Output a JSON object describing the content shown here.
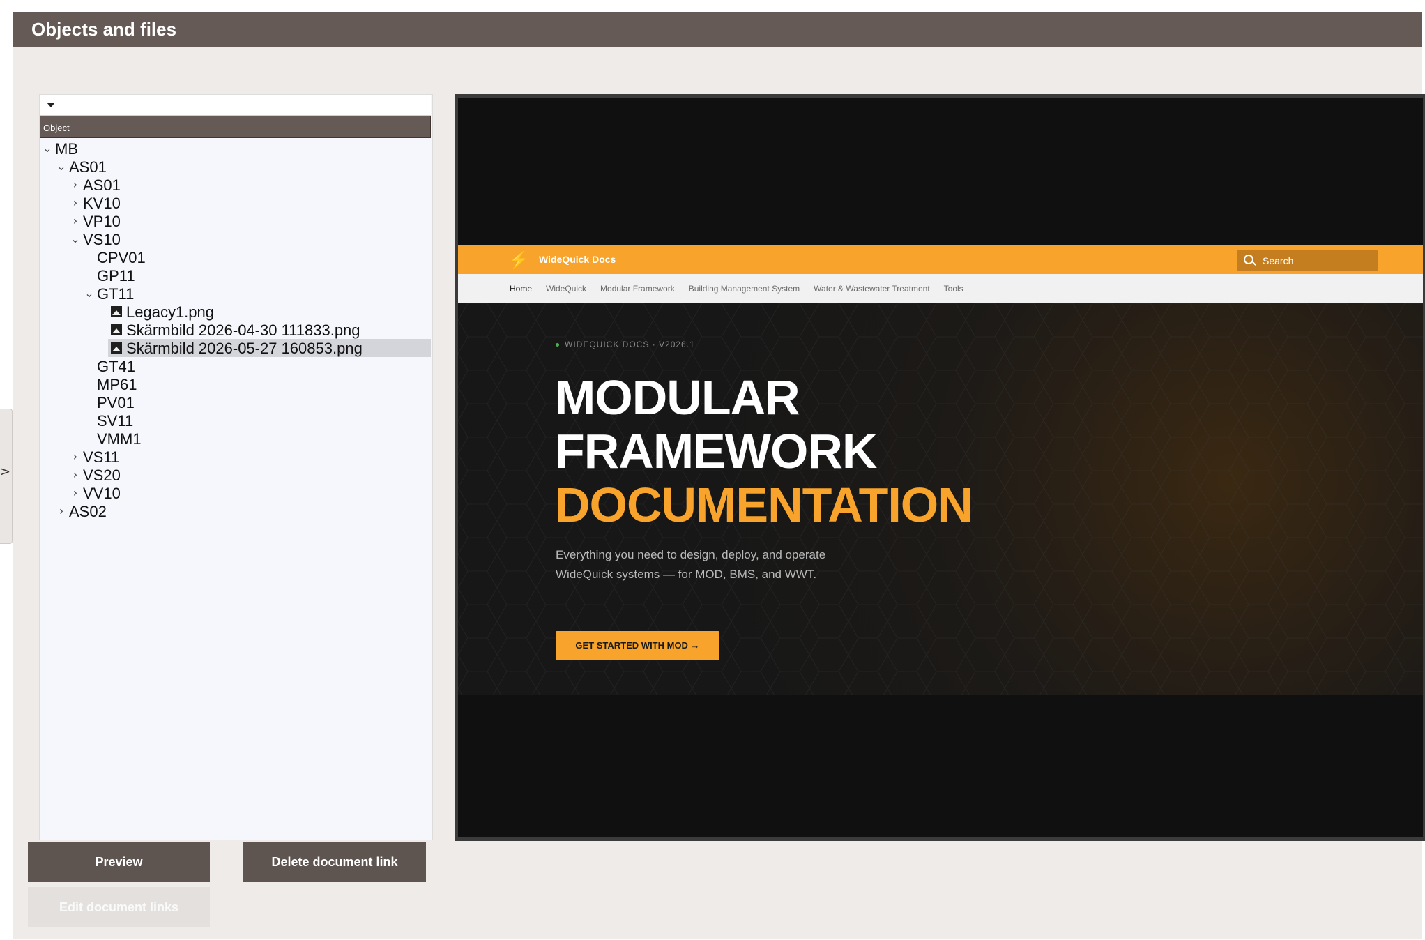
{
  "window": {
    "title": "Objects and files"
  },
  "side_toggle": {
    "arrow": ">"
  },
  "panel": {
    "column_header": "Object",
    "tree": [
      {
        "label": "MB",
        "expander": "⌄"
      },
      {
        "label": "AS01",
        "expander": "⌄"
      },
      {
        "label": "AS01",
        "expander": "›"
      },
      {
        "label": "KV10",
        "expander": "›"
      },
      {
        "label": "VP10",
        "expander": "›"
      },
      {
        "label": "VS10",
        "expander": "⌄"
      },
      {
        "label": "CPV01",
        "expander": ""
      },
      {
        "label": "GP11",
        "expander": ""
      },
      {
        "label": "GT11",
        "expander": "⌄"
      },
      {
        "label": "Legacy1.png",
        "expander": "",
        "icon": "image-file-icon"
      },
      {
        "label": "Skärmbild 2026-04-30 111833.png",
        "expander": "",
        "icon": "image-file-icon"
      },
      {
        "label": "Skärmbild 2026-05-27 160853.png",
        "expander": "",
        "icon": "image-file-icon",
        "selected": true
      },
      {
        "label": "GT41",
        "expander": ""
      },
      {
        "label": "MP61",
        "expander": ""
      },
      {
        "label": "PV01",
        "expander": ""
      },
      {
        "label": "SV11",
        "expander": ""
      },
      {
        "label": "VMM1",
        "expander": ""
      },
      {
        "label": "VS11",
        "expander": "›"
      },
      {
        "label": "VS20",
        "expander": "›"
      },
      {
        "label": "VV10",
        "expander": "›"
      },
      {
        "label": "AS02",
        "expander": "›"
      }
    ]
  },
  "buttons": {
    "preview": "Preview",
    "delete_link": "Delete document link",
    "edit_links": "Edit document links"
  },
  "preview_image": {
    "brand": "WideQuick Docs",
    "search_placeholder": "Search",
    "nav": [
      "Home",
      "WideQuick",
      "Modular Framework",
      "Building Management System",
      "Water & Wastewater Treatment",
      "Tools"
    ],
    "crumb_left": "WIDEQUICK DOCS",
    "crumb_sep": "·",
    "crumb_right": "V2026.1",
    "headline_1": "MODULAR",
    "headline_2": "FRAMEWORK",
    "headline_3": "DOCUMENTATION",
    "description": "Everything you need to design, deploy, and operate WideQuick systems — for MOD, BMS, and WWT.",
    "cta": "GET STARTED WITH MOD →",
    "colors": {
      "accent": "#f8a32b",
      "header": "#655a55"
    }
  }
}
